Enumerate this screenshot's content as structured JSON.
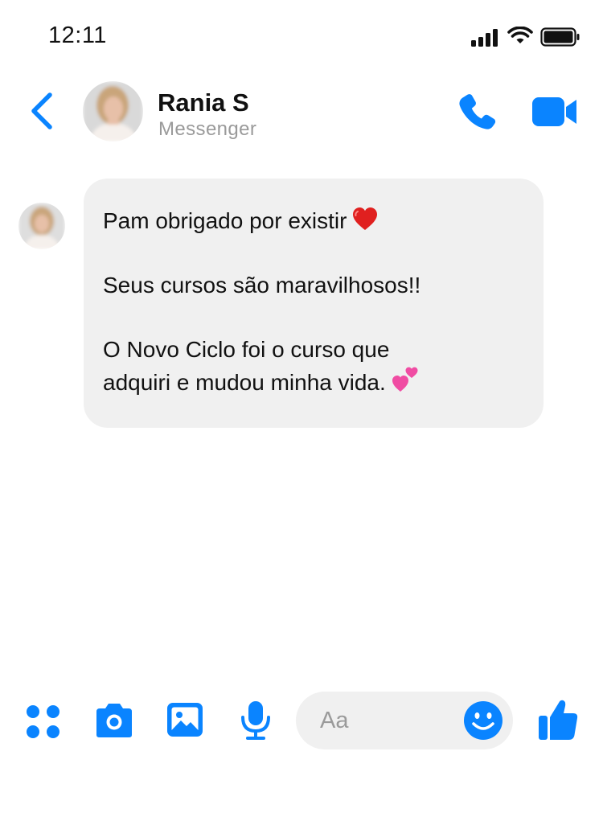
{
  "status_bar": {
    "time": "12:11",
    "icons": [
      "signal-icon",
      "wifi-icon",
      "battery-icon"
    ]
  },
  "header": {
    "back_icon": "chevron-left-icon",
    "contact_name": "Rania S",
    "contact_subtitle": "Messenger",
    "actions": [
      "phone-icon",
      "video-camera-icon"
    ]
  },
  "conversation": {
    "messages": [
      {
        "lines": [
          "Pam obrigado por existir",
          "",
          "Seus cursos são maravilhosos!!",
          "",
          "O Novo Ciclo foi o curso que",
          "adquiri e mudou minha vida."
        ],
        "emojis": [
          "red-heart-emoji",
          "two-hearts-emoji"
        ]
      }
    ]
  },
  "composer": {
    "placeholder": "Aa",
    "value": "",
    "icons": [
      "apps-icon",
      "camera-icon",
      "gallery-icon",
      "microphone-icon",
      "emoji-icon",
      "thumbs-up-icon"
    ]
  },
  "colors": {
    "accent": "#0a84ff",
    "bubble": "#f0f0f0",
    "subtitle": "#9a9a9a",
    "heart": "#e0201f",
    "pink_hearts": "#f04ca3"
  }
}
